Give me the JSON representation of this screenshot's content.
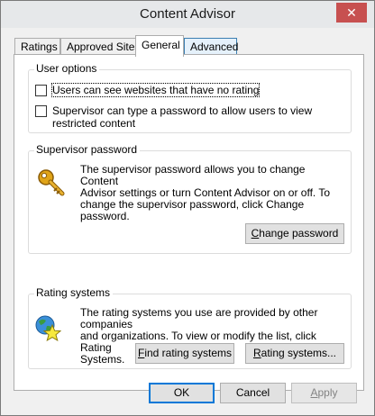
{
  "window": {
    "title": "Content Advisor",
    "close_glyph": "✕"
  },
  "tabs": [
    {
      "label": "Ratings"
    },
    {
      "label": "Approved Sites"
    },
    {
      "label": "General"
    },
    {
      "label": "Advanced"
    }
  ],
  "user_options": {
    "label": "User options",
    "option1": "Users can see websites that have no rating",
    "option2_line1": "Supervisor can type a password to allow users to view",
    "option2_line2": "restricted content"
  },
  "supervisor_password": {
    "label": "Supervisor password",
    "desc_l1": "The supervisor password allows you to change Content",
    "desc_l2": "Advisor settings or turn Content Advisor on or off. To",
    "desc_l3": "change the supervisor password, click Change",
    "desc_l4": "password.",
    "change_btn_first": "C",
    "change_btn_rest": "hange password",
    "icon": "key-icon"
  },
  "rating_systems": {
    "label": "Rating systems",
    "desc_l1": "The rating systems you use are provided by other companies",
    "desc_l2": "and organizations. To view or modify the list, click Rating",
    "desc_l3": "Systems.",
    "find_btn_first": "F",
    "find_btn_rest": "ind rating systems",
    "systems_btn_first": "R",
    "systems_btn_rest": "ating systems...",
    "icon": "globe-star-icon"
  },
  "footer": {
    "ok": "OK",
    "cancel": "Cancel",
    "apply_first": "A",
    "apply_rest": "pply"
  }
}
